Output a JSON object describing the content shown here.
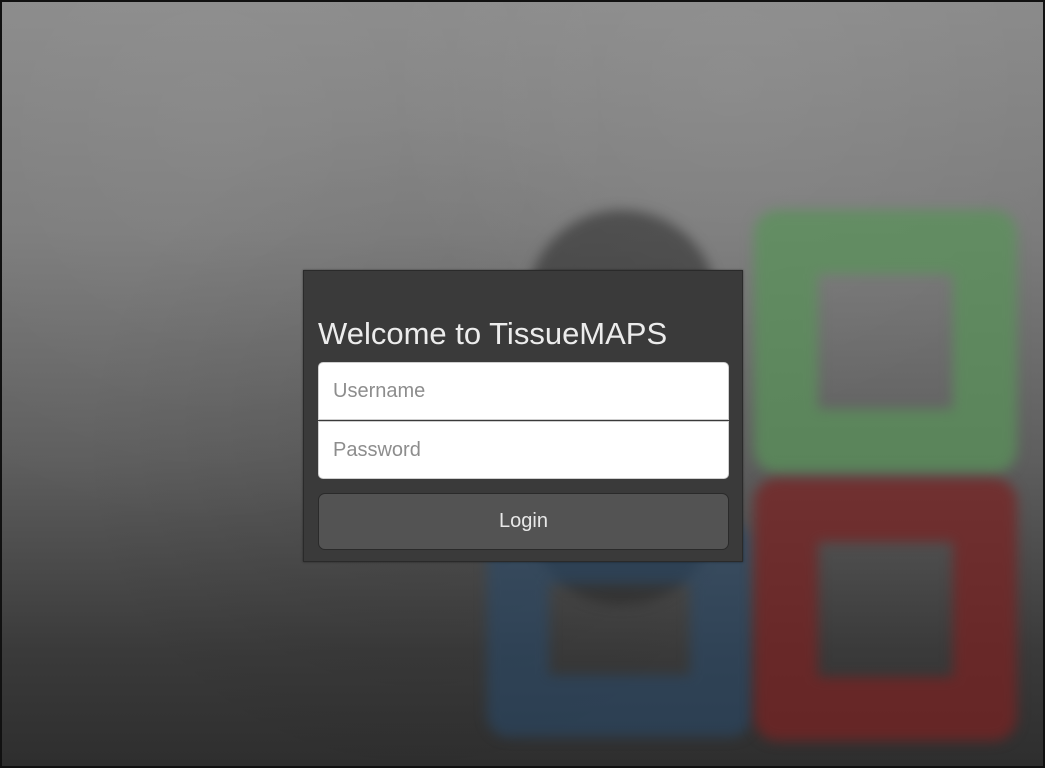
{
  "login": {
    "title": "Welcome to TissueMAPS",
    "username_placeholder": "Username",
    "password_placeholder": "Password",
    "button_label": "Login"
  },
  "colors": {
    "panel_bg": "#3a3a3a",
    "button_bg": "#535353",
    "logo_green": "#5a915a",
    "logo_red": "#782323",
    "logo_blue": "#284b6e"
  }
}
